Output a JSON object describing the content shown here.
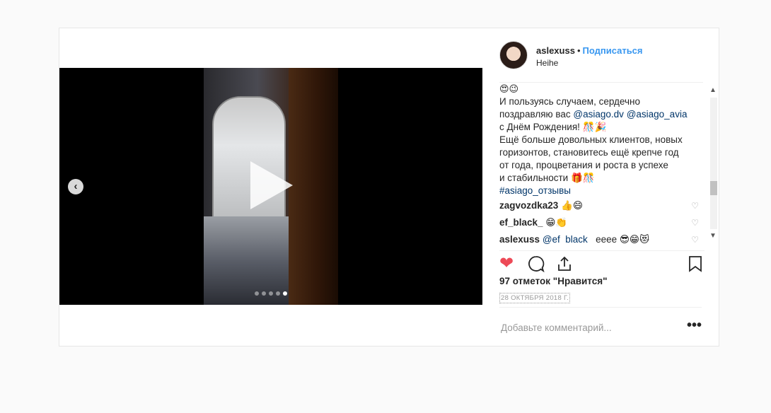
{
  "post": {
    "username": "aslexuss",
    "bullet": "•",
    "follow_label": "Подписаться",
    "location": "Heihe"
  },
  "caption": {
    "line0": "😍😉",
    "line1": "И пользуясь случаем, сердечно",
    "line2_prefix": "поздравляю вас ",
    "tag1": "@asiago.dv",
    "tag2": "@asiago_avia",
    "line3": "с Днём Рождения! 🎊🎉",
    "line4": "Ещё больше довольных клиентов, новых",
    "line5": "горизонтов, становитесь ещё крепче год",
    "line6": "от года, процветания и роста в успехе",
    "line7": "и стабильности 🎁🎊",
    "hashtag": "#asiago_отзывы"
  },
  "comments": [
    {
      "user": "zagvozdka23",
      "text": "👍😄"
    },
    {
      "user": "ef_black_",
      "text": "😁👏"
    },
    {
      "user": "aslexuss",
      "mention": "@ef_black_",
      "text": "eeee 😎😁😻"
    }
  ],
  "likes_text": "97 отметок \"Нравится\"",
  "date": "28 ОКТЯБРЯ 2018 Г.",
  "add_comment_placeholder": "Добавьте комментарий...",
  "icons": {
    "heart": "heart-icon",
    "comment": "comment-icon",
    "share": "share-icon",
    "bookmark": "bookmark-icon"
  },
  "colors": {
    "like_red": "#ed4956",
    "follow_blue": "#3897f0",
    "tag_blue": "#003569"
  },
  "carousel": {
    "count": 5,
    "active_index": 4
  }
}
